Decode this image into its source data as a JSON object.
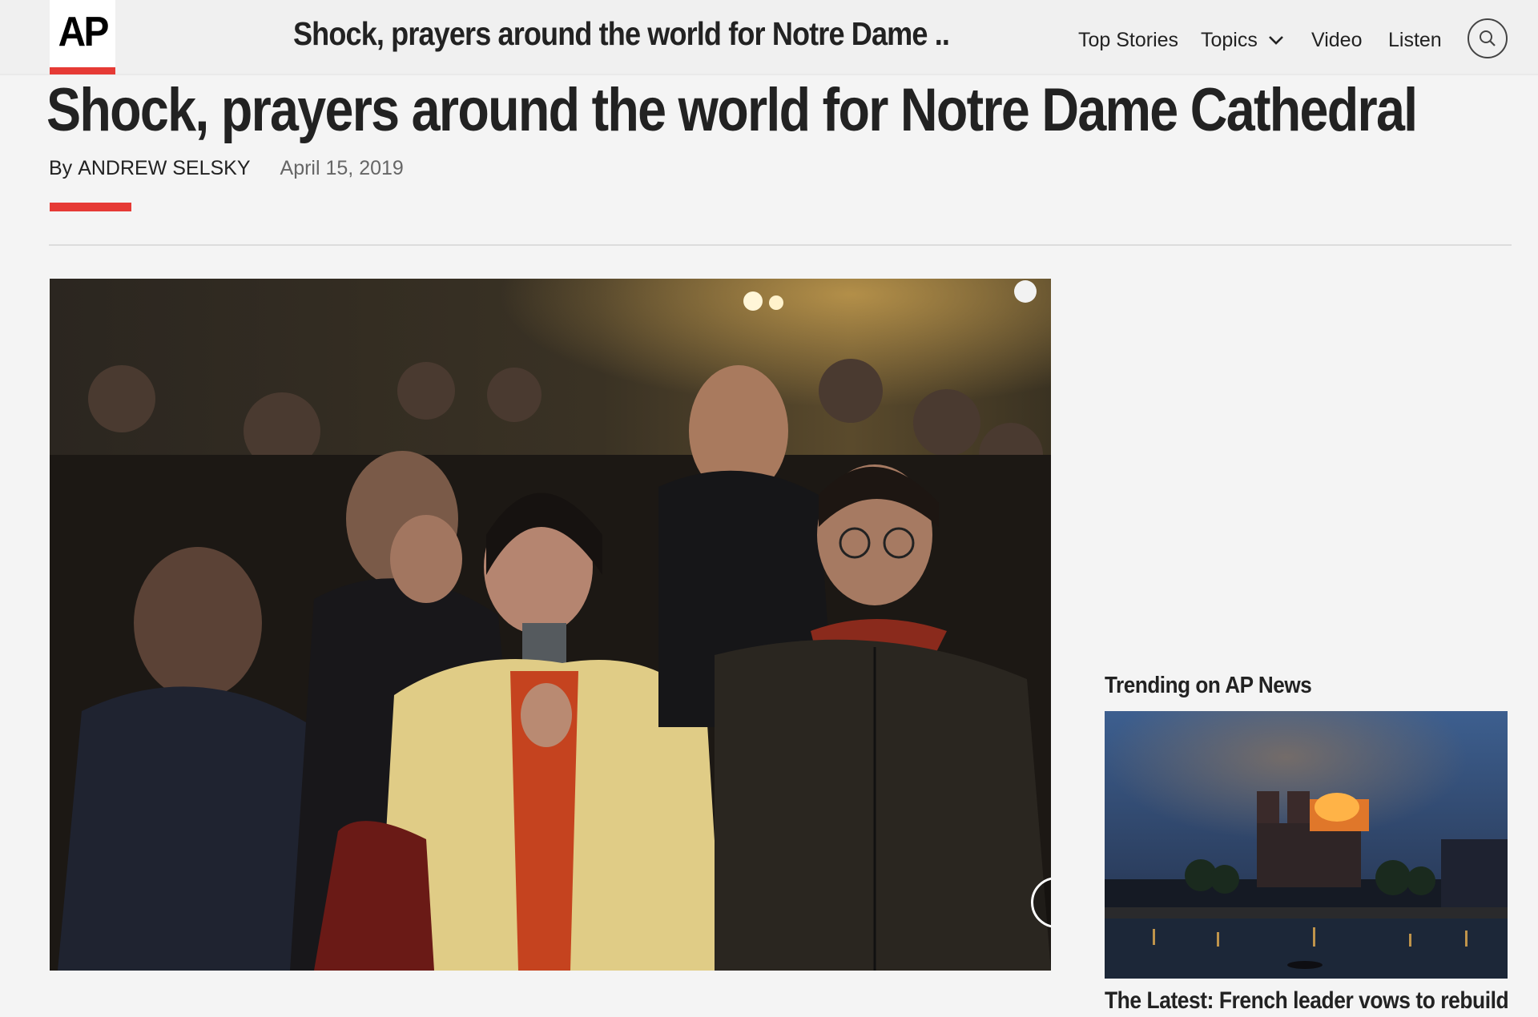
{
  "header": {
    "logo": "AP",
    "title": "Shock, prayers around the world for Notre Dame ...",
    "nav": {
      "top_stories": "Top Stories",
      "topics": "Topics",
      "video": "Video",
      "listen": "Listen"
    },
    "icons": {
      "topics": "chevron-down-icon",
      "search": "search-icon"
    }
  },
  "article": {
    "headline": "Shock, prayers around the world for Notre Dame Cathedral",
    "byline_prefix": "By",
    "author": "ANDREW SELSKY",
    "date": "April 15, 2019"
  },
  "gallery": {
    "next_icon": "chevron-right-icon"
  },
  "sidebar": {
    "trending_title": "Trending on AP News",
    "trending_headline": "The Latest: French leader vows to rebuild"
  },
  "colors": {
    "accent": "#e63a35",
    "header_bg": "#f0f0f0",
    "page_bg": "#f4f4f4",
    "text": "#222222"
  }
}
